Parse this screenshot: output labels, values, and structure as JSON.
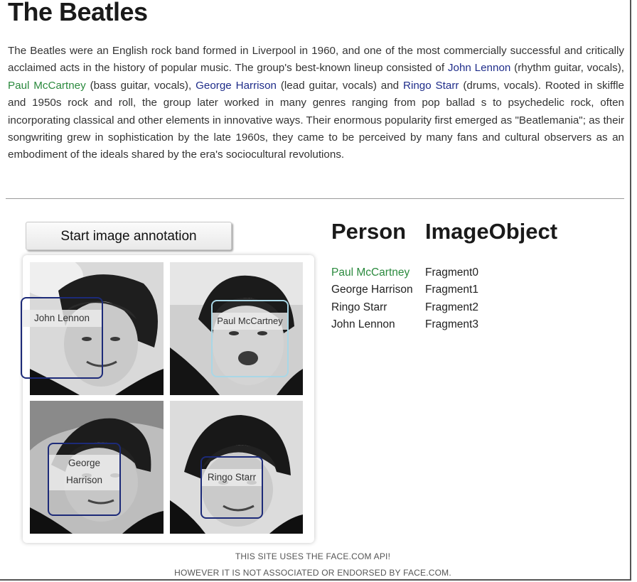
{
  "title": "The Beatles",
  "intro": {
    "p1": "The Beatles were an English rock band formed in Liverpool in 1960, and one of the most commercially successful and critically acclaimed acts in the history of popular music. The group's best-known lineup consisted of ",
    "link_lennon": "John Lennon",
    "p2": " (rhythm guitar, vocals), ",
    "link_mccartney": "Paul McCartney",
    "p3": " (bass guitar, vocals), ",
    "link_harrison": "George Harrison",
    "p4": " (lead guitar, vocals) and ",
    "link_starr": "Ringo Starr",
    "p5": " (drums, vocals). Rooted in skiffle and 1950s rock and roll, the group later worked in many genres ranging from pop ballad s to psychedelic rock, often incorporating classical and other elements in innovative ways. Their enormous popularity first emerged as \"Beatlemania\"; as their songwriting grew in sophistication by the late 1960s, they came to be perceived by many fans and cultural observers as an embodiment of the ideals shared by the era's sociocultural revolutions."
  },
  "annotate_button": "Start image annotation",
  "faces": {
    "lennon": "John Lennon",
    "mccartney": "Paul McCartney",
    "harrison_line1": "George",
    "harrison_line2": "Harrison",
    "starr": "Ringo Starr"
  },
  "table": {
    "col_person": "Person",
    "col_image": "ImageObject",
    "rows": [
      {
        "person": "Paul McCartney",
        "object": "Fragment0"
      },
      {
        "person": "George Harrison",
        "object": "Fragment1"
      },
      {
        "person": "Ringo Starr",
        "object": "Fragment2"
      },
      {
        "person": "John Lennon",
        "object": "Fragment3"
      }
    ]
  },
  "footer": {
    "line1": "THIS SITE USES THE FACE.COM API!",
    "line2": "HOWEVER IT IS NOT ASSOCIATED OR ENDORSED BY FACE.COM."
  },
  "colors": {
    "link_blue": "#1f2d8a",
    "link_green": "#2b8a3e",
    "box_dark": "#1c2a78",
    "box_light": "#a9d7e6"
  }
}
